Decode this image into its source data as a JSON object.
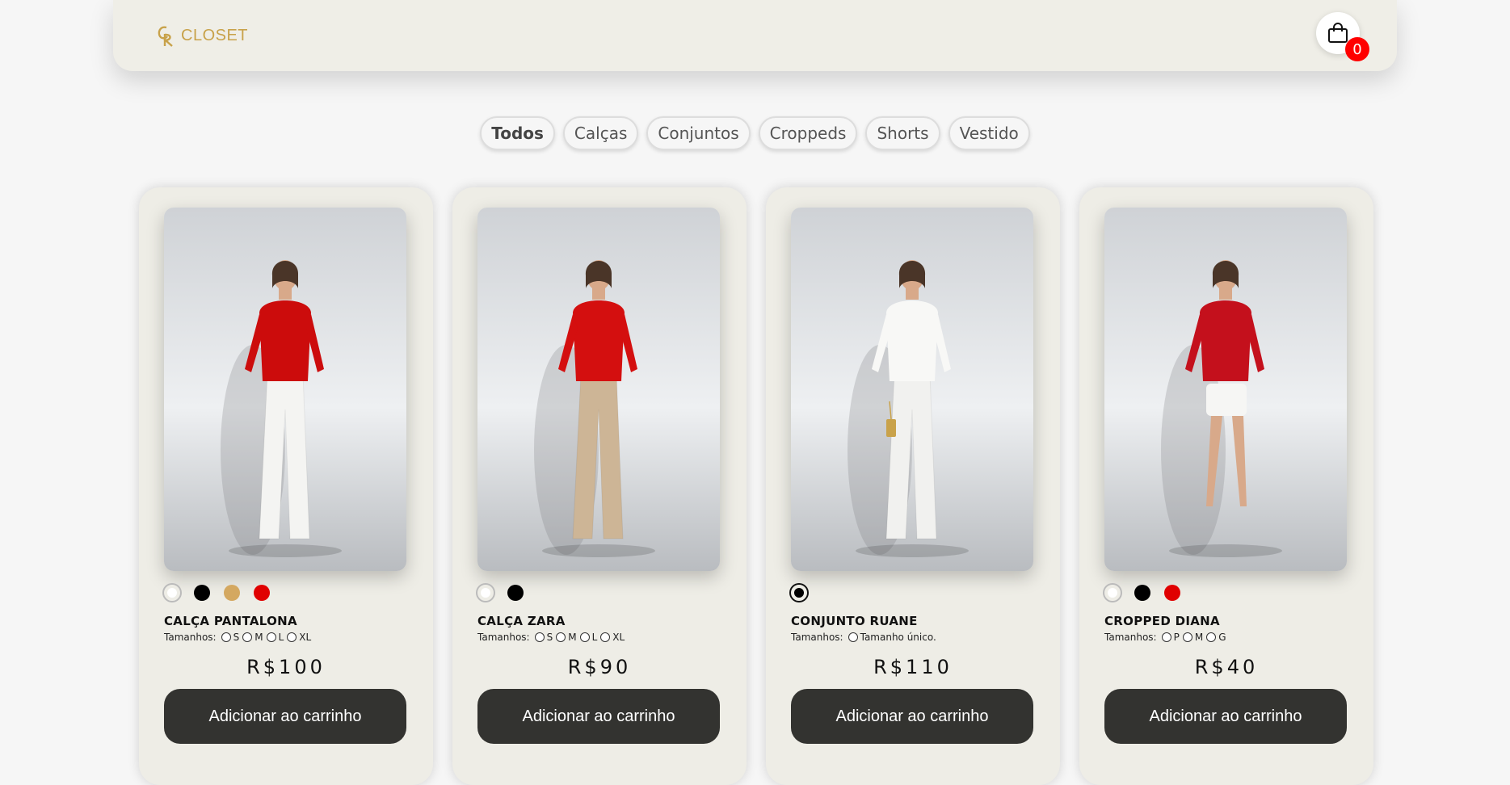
{
  "header": {
    "logo_text": "CLOSET",
    "cart_count": "0"
  },
  "filters": [
    "Todos",
    "Calças",
    "Conjuntos",
    "Croppeds",
    "Shorts",
    "Vestido"
  ],
  "active_filter": "Todos",
  "products": [
    {
      "name": "CALÇA PANTALONA",
      "sizes_label": "Tamanhos:",
      "sizes": [
        "S",
        "M",
        "L",
        "XL"
      ],
      "price": "R$100",
      "button": "Adicionar ao carrinho",
      "colors": [
        "#ffffff",
        "#000000",
        "#d4a860",
        "#e00000"
      ],
      "outfit": {
        "top": "#cc0c0c",
        "bottom": "#f4f4f2",
        "bag": ""
      }
    },
    {
      "name": "CALÇA ZARA",
      "sizes_label": "Tamanhos:",
      "sizes": [
        "S",
        "M",
        "L",
        "XL"
      ],
      "price": "R$90",
      "button": "Adicionar ao carrinho",
      "colors": [
        "#ffffff",
        "#000000"
      ],
      "outfit": {
        "top": "#d40f0f",
        "bottom": "#cdb596",
        "bag": ""
      }
    },
    {
      "name": "CONJUNTO RUANE",
      "sizes_label": "Tamanhos:",
      "sizes": [
        "Tamanho único."
      ],
      "price": "R$110",
      "button": "Adicionar ao carrinho",
      "colors": [
        "#000000"
      ],
      "outfit": {
        "top": "#f8f8f6",
        "bottom": "#f1f1ef",
        "bag": "#c9a24a"
      }
    },
    {
      "name": "CROPPED DIANA",
      "sizes_label": "Tamanhos:",
      "sizes": [
        "P",
        "M",
        "G"
      ],
      "price": "R$40",
      "button": "Adicionar ao carrinho",
      "colors": [
        "#ffffff",
        "#000000",
        "#e00000"
      ],
      "outfit": {
        "top": "#c4101c",
        "bottom": "#f6f6f4",
        "bag": ""
      }
    }
  ]
}
